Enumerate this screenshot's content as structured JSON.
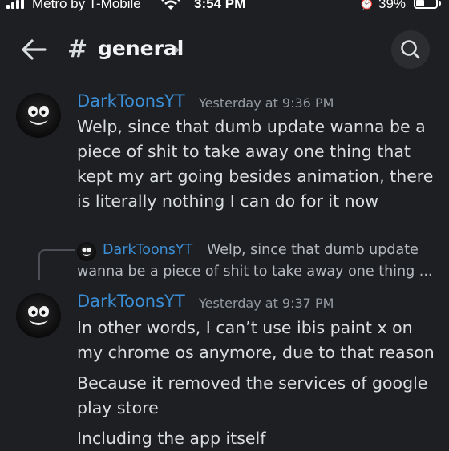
{
  "status_bar": {
    "carrier": "Metro by T-Mobile",
    "time": "3:54 PM",
    "battery_percent": "39%",
    "battery_level": 0.39,
    "icons": [
      "signal-icon",
      "wifi-icon",
      "alarm-icon",
      "battery-icon"
    ]
  },
  "header": {
    "hash": "#",
    "channel_name": "general",
    "chevron": "›",
    "icons": [
      "back-arrow-icon",
      "search-icon"
    ]
  },
  "messages": [
    {
      "author": "DarkToonsYT",
      "timestamp": "Yesterday at 9:36 PM",
      "lines": [
        "Welp, since that dumb update wanna be a piece of shit to take away one thing that kept my art going besides animation, there is literally nothing I can do for it now"
      ]
    },
    {
      "reply": {
        "author": "DarkToonsYT",
        "text_line1": "Welp, since that dumb update",
        "text_line2": "wanna be a piece of shit to take away one thing ..."
      },
      "author": "DarkToonsYT",
      "timestamp": "Yesterday at 9:37 PM",
      "lines": [
        "In other words, I can’t use ibis paint x on my chrome os anymore, due to that reason",
        "Because it removed the services of google play store",
        "Including the app itself"
      ]
    }
  ],
  "colors": {
    "background": "#1e1f22",
    "author_name": "#3b8fd6",
    "message_text": "#dbdee1",
    "timestamp": "#949ba4"
  }
}
